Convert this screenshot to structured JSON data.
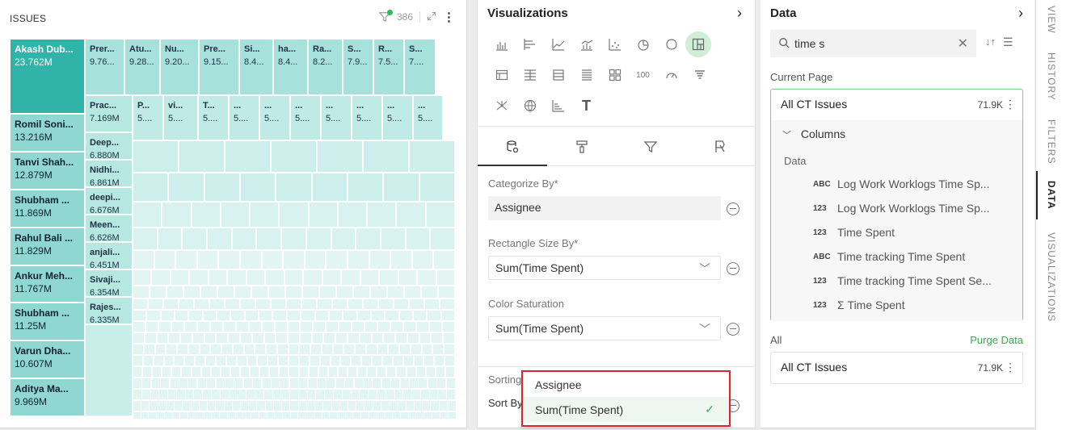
{
  "treemap": {
    "title": "ISSUES",
    "filter_count": "386",
    "main_tile": {
      "name": "Akash Dub...",
      "value": "23.762M"
    },
    "left_column": [
      {
        "name": "Romil Soni...",
        "value": "13.216M"
      },
      {
        "name": "Tanvi Shah...",
        "value": "12.879M"
      },
      {
        "name": "Shubham ...",
        "value": "11.869M"
      },
      {
        "name": "Rahul Bali ...",
        "value": "11.829M"
      },
      {
        "name": "Ankur Meh...",
        "value": "11.767M"
      },
      {
        "name": "Shubham ...",
        "value": "11.25M"
      },
      {
        "name": "Varun Dha...",
        "value": "10.607M"
      },
      {
        "name": "Aditya Ma...",
        "value": "9.969M"
      }
    ],
    "top_row": [
      {
        "name": "Prer...",
        "value": "9.76..."
      },
      {
        "name": "Atu...",
        "value": "9.28..."
      },
      {
        "name": "Nu...",
        "value": "9.20..."
      },
      {
        "name": "Pre...",
        "value": "9.15..."
      },
      {
        "name": "Si...",
        "value": "8.4..."
      },
      {
        "name": "ha...",
        "value": "8.4..."
      },
      {
        "name": "Ra...",
        "value": "8.2..."
      },
      {
        "name": "S...",
        "value": "7.9..."
      },
      {
        "name": "R...",
        "value": "7.5..."
      },
      {
        "name": "S...",
        "value": "7...."
      }
    ],
    "second_column": [
      {
        "name": "Prac...",
        "value": "7.169M"
      },
      {
        "name": "Deep...",
        "value": "6.880M"
      },
      {
        "name": "Nidhi...",
        "value": "6.861M"
      },
      {
        "name": "deepi...",
        "value": "6.676M"
      },
      {
        "name": "Meen...",
        "value": "6.626M"
      },
      {
        "name": "anjali...",
        "value": "6.451M"
      },
      {
        "name": "Sivaji...",
        "value": "6.354M"
      },
      {
        "name": "Rajes...",
        "value": "6.335M"
      }
    ],
    "second_row": [
      {
        "name": "P...",
        "value": "5...."
      },
      {
        "name": "vi...",
        "value": "5...."
      },
      {
        "name": "T...",
        "value": "5...."
      },
      {
        "name": "...",
        "value": "5...."
      },
      {
        "name": "...",
        "value": "5...."
      },
      {
        "name": "...",
        "value": "5...."
      },
      {
        "name": "...",
        "value": "5...."
      },
      {
        "name": "...",
        "value": "5...."
      },
      {
        "name": "...",
        "value": "5...."
      },
      {
        "name": "...",
        "value": "5...."
      }
    ],
    "colors": {
      "high": "#30b3a8",
      "mid": "#a6e1db",
      "low": "#e2f5f2"
    }
  },
  "visualizations": {
    "title": "Visualizations",
    "icons_row1": [
      "bar-chart-icon",
      "horizontal-bar-icon",
      "line-chart-icon",
      "combo-chart-icon",
      "scatter-icon",
      "pie-chart-icon",
      "donut-icon",
      "treemap-icon"
    ],
    "icons_row2": [
      "pivot-icon",
      "table-icon",
      "grid-icon",
      "list-icon",
      "cards-icon",
      "kpi-icon",
      "gauge-icon",
      "funnel-icon"
    ],
    "icons_row3": [
      "network-icon",
      "map-icon",
      "sorted-bar-icon",
      "text-icon"
    ],
    "kpi_label": "100",
    "text_label": "T",
    "categorize_by_label": "Categorize By*",
    "categorize_by_value": "Assignee",
    "rect_size_label": "Rectangle Size By*",
    "rect_size_value": "Sum(Time Spent)",
    "color_sat_label": "Color Saturation",
    "color_sat_value": "Sum(Time Spent)",
    "sorting_label": "Sorting",
    "sort_by_label": "Sort By",
    "sort_dropdown": {
      "options": [
        "Assignee",
        "Sum(Time Spent)"
      ],
      "selected": "Sum(Time Spent)"
    }
  },
  "data_panel": {
    "title": "Data",
    "search_value": "time s",
    "current_page_label": "Current Page",
    "source_name": "All CT Issues",
    "source_count": "71.9K",
    "columns_label": "Columns",
    "data_group_label": "Data",
    "fields": [
      {
        "type": "ABC",
        "name": "Log Work Worklogs Time Sp..."
      },
      {
        "type": "123",
        "name": "Log Work Worklogs Time Sp..."
      },
      {
        "type": "123",
        "name": "Time Spent"
      },
      {
        "type": "ABC",
        "name": "Time tracking Time Spent"
      },
      {
        "type": "123",
        "name": "Time tracking Time Spent Se..."
      },
      {
        "type": "123",
        "name": "Σ Time Spent"
      }
    ],
    "all_label": "All",
    "purge_label": "Purge Data",
    "all_source_name": "All CT Issues",
    "all_source_count": "71.9K"
  },
  "rail": {
    "items": [
      "VIEW",
      "HISTORY",
      "FILTERS",
      "DATA",
      "VISUALIZATIONS"
    ],
    "active": "DATA"
  }
}
